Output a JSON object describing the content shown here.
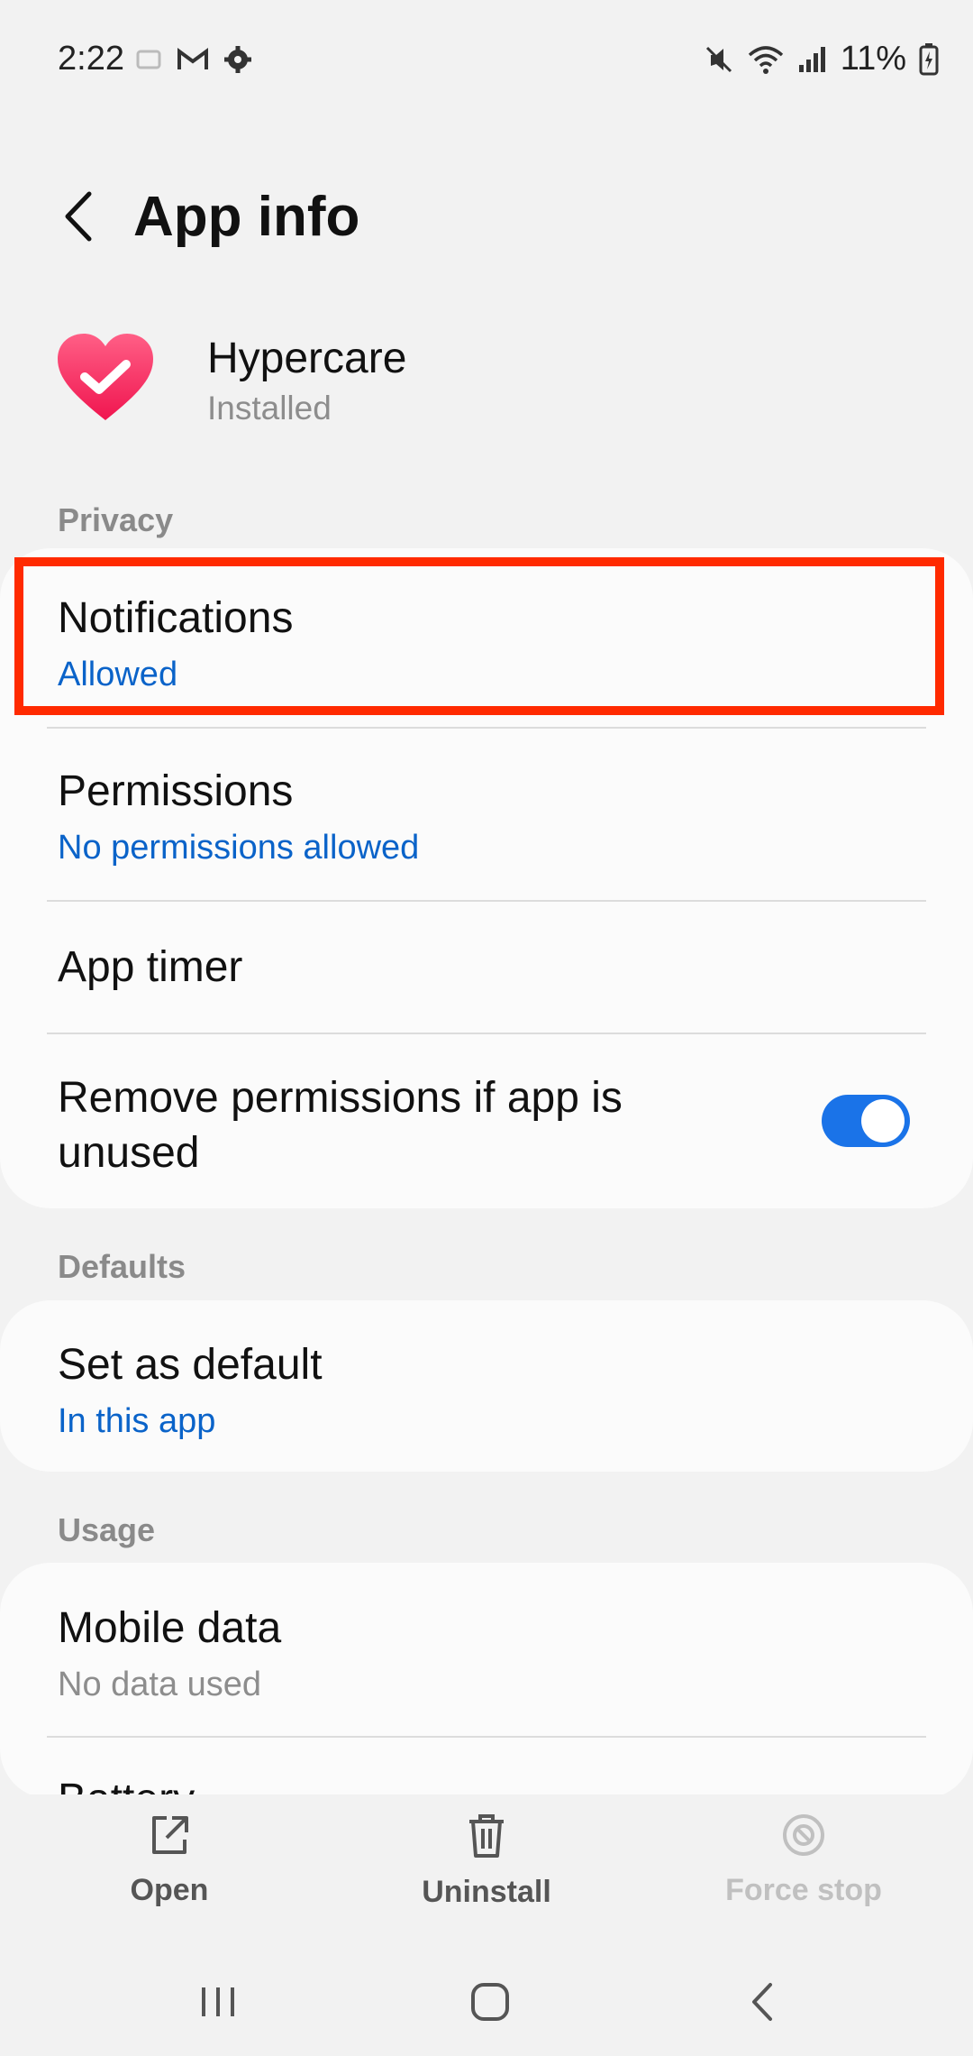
{
  "status_bar": {
    "time": "2:22",
    "battery": "11%",
    "left_icons": [
      "notification-icon",
      "gmail-icon",
      "settings-icon"
    ],
    "right_icons": [
      "mute-icon",
      "wifi-icon",
      "signal-icon",
      "battery-charging-icon"
    ]
  },
  "header": {
    "title": "App info"
  },
  "app": {
    "name": "Hypercare",
    "status": "Installed",
    "icon_color": "#ff3b6a"
  },
  "sections": {
    "privacy": "Privacy",
    "defaults": "Defaults",
    "usage": "Usage"
  },
  "items": {
    "notifications": {
      "title": "Notifications",
      "subtitle": "Allowed"
    },
    "permissions": {
      "title": "Permissions",
      "subtitle": "No permissions allowed"
    },
    "app_timer": {
      "title": "App timer"
    },
    "remove_permissions": {
      "title_line1": "Remove permissions if app is",
      "title_line2": "unused",
      "toggle_on": true
    },
    "set_default": {
      "title": "Set as default",
      "subtitle": "In this app"
    },
    "mobile_data": {
      "title": "Mobile data",
      "subtitle": "No data used"
    },
    "battery": {
      "title": "Battery"
    }
  },
  "actions": {
    "open": "Open",
    "uninstall": "Uninstall",
    "force_stop": "Force stop"
  },
  "colors": {
    "accent": "#0a63c9",
    "highlight": "#ff2a00",
    "toggle": "#1a73e8"
  }
}
